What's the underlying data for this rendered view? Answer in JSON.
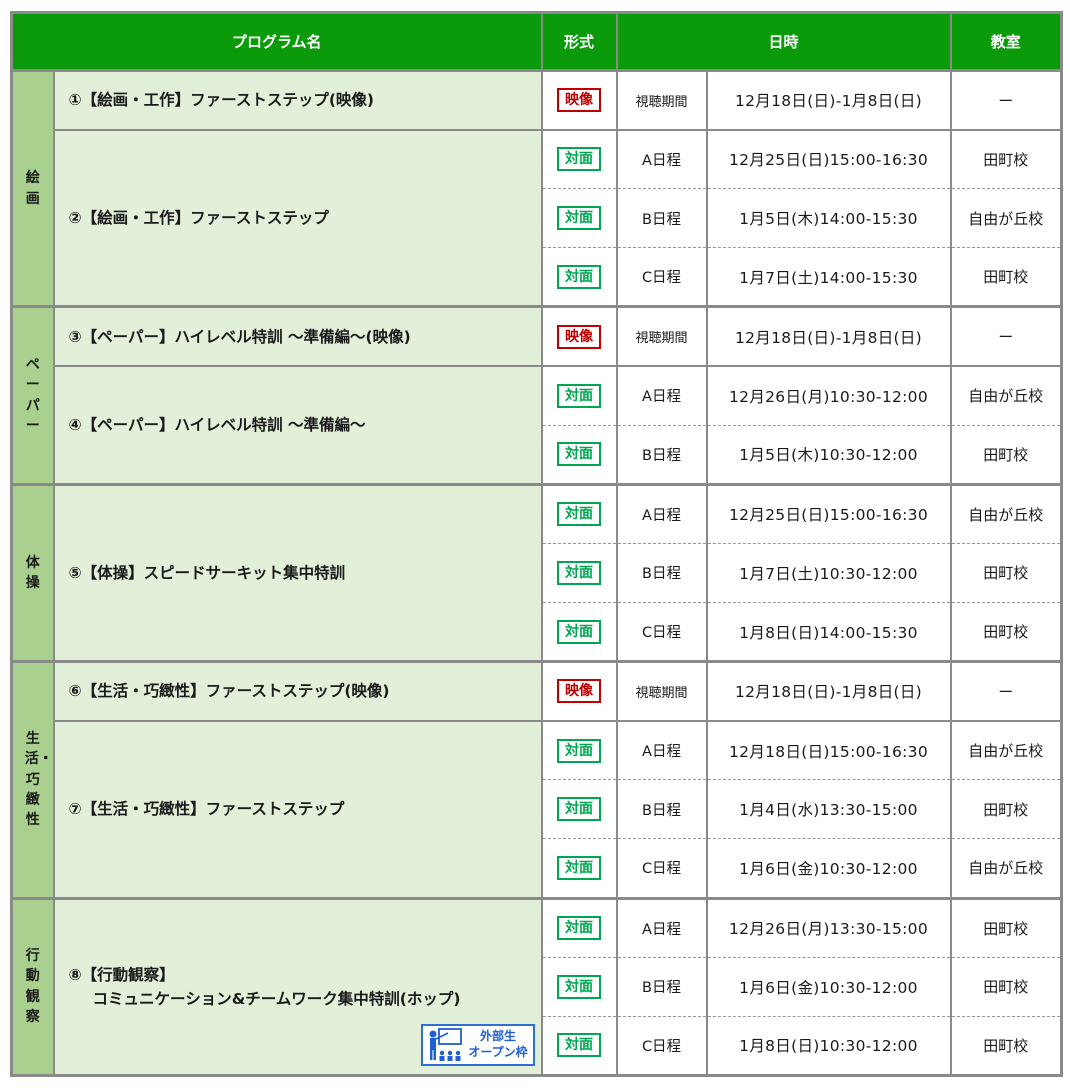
{
  "header": {
    "program": "プログラム名",
    "format": "形式",
    "datetime": "日時",
    "room": "教室"
  },
  "badges": {
    "video": "映像",
    "live": "対面"
  },
  "open_badge": {
    "line1": "外部生",
    "line2": "オープン枠",
    "icon": "teacher-students-icon"
  },
  "categories": {
    "drawing": "絵画",
    "paper": "ペーパー",
    "exercise": "体操",
    "life": "生活・巧緻性",
    "behavior": "行動観察"
  },
  "programs": {
    "p1": "①【絵画・工作】ファーストステップ(映像)",
    "p2": "②【絵画・工作】ファーストステップ",
    "p3": "③【ペーパー】ハイレベル特訓 ～準備編～(映像)",
    "p4": "④【ペーパー】ハイレベル特訓 ～準備編～",
    "p5": "⑤【体操】スピードサーキット集中特訓",
    "p6": "⑥【生活・巧緻性】ファーストステップ(映像)",
    "p7": "⑦【生活・巧緻性】ファーストステップ",
    "p8_line1": "⑧【行動観察】",
    "p8_line2": "コミュニケーション&チームワーク集中特訓(ホップ)"
  },
  "rows": [
    {
      "label": "視聴期間",
      "datetime": "12月18日(日)-1月8日(日)",
      "room": "ー"
    },
    {
      "label": "A日程",
      "datetime": "12月25日(日)15:00-16:30",
      "room": "田町校"
    },
    {
      "label": "B日程",
      "datetime": "1月5日(木)14:00-15:30",
      "room": "自由が丘校"
    },
    {
      "label": "C日程",
      "datetime": "1月7日(土)14:00-15:30",
      "room": "田町校"
    },
    {
      "label": "視聴期間",
      "datetime": "12月18日(日)-1月8日(日)",
      "room": "ー"
    },
    {
      "label": "A日程",
      "datetime": "12月26日(月)10:30-12:00",
      "room": "自由が丘校"
    },
    {
      "label": "B日程",
      "datetime": "1月5日(木)10:30-12:00",
      "room": "田町校"
    },
    {
      "label": "A日程",
      "datetime": "12月25日(日)15:00-16:30",
      "room": "自由が丘校"
    },
    {
      "label": "B日程",
      "datetime": "1月7日(土)10:30-12:00",
      "room": "田町校"
    },
    {
      "label": "C日程",
      "datetime": "1月8日(日)14:00-15:30",
      "room": "田町校"
    },
    {
      "label": "視聴期間",
      "datetime": "12月18日(日)-1月8日(日)",
      "room": "ー"
    },
    {
      "label": "A日程",
      "datetime": "12月18日(日)15:00-16:30",
      "room": "自由が丘校"
    },
    {
      "label": "B日程",
      "datetime": "1月4日(水)13:30-15:00",
      "room": "田町校"
    },
    {
      "label": "C日程",
      "datetime": "1月6日(金)10:30-12:00",
      "room": "自由が丘校"
    },
    {
      "label": "A日程",
      "datetime": "12月26日(月)13:30-15:00",
      "room": "田町校"
    },
    {
      "label": "B日程",
      "datetime": "1月6日(金)10:30-12:00",
      "room": "田町校"
    },
    {
      "label": "C日程",
      "datetime": "1月8日(日)10:30-12:00",
      "room": "田町校"
    }
  ],
  "colors": {
    "header_bg": "#0a9a0a",
    "category_bg": "#a9d08e",
    "program_bg": "#e2efd9",
    "video_badge": "#c00000",
    "live_badge": "#00a651",
    "open_badge": "#2e6fd6"
  }
}
